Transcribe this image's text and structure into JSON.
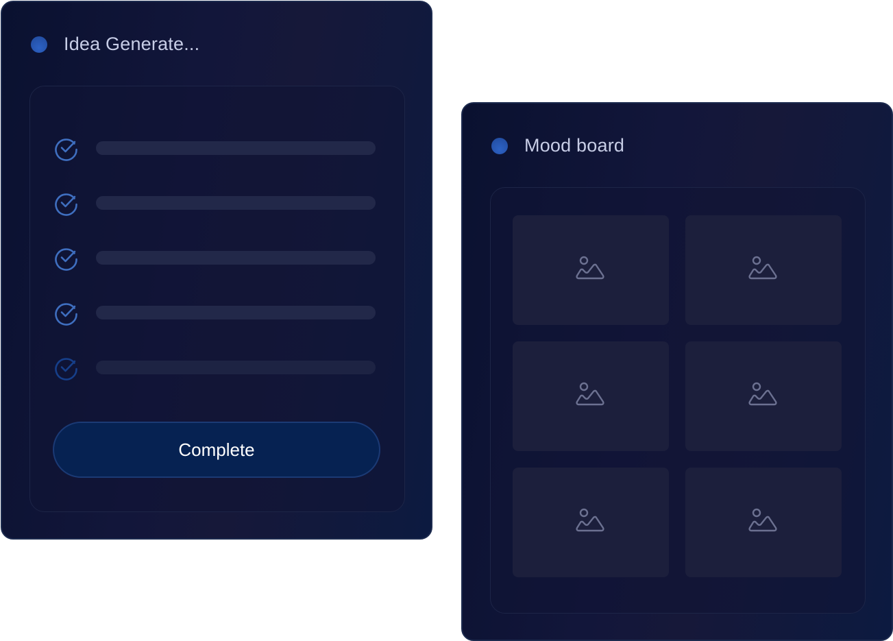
{
  "idea_card": {
    "title": "Idea Generate...",
    "tasks": [
      {
        "state": "done",
        "icon": "check-circle-icon"
      },
      {
        "state": "done",
        "icon": "check-circle-icon"
      },
      {
        "state": "done",
        "icon": "check-circle-icon"
      },
      {
        "state": "done",
        "icon": "check-circle-icon"
      },
      {
        "state": "pending",
        "icon": "check-circle-icon"
      }
    ],
    "complete_label": "Complete"
  },
  "mood_card": {
    "title": "Mood board",
    "tiles": [
      {
        "icon": "image-placeholder-icon"
      },
      {
        "icon": "image-placeholder-icon"
      },
      {
        "icon": "image-placeholder-icon"
      },
      {
        "icon": "image-placeholder-icon"
      },
      {
        "icon": "image-placeholder-icon"
      },
      {
        "icon": "image-placeholder-icon"
      }
    ]
  },
  "colors": {
    "check_done": "#3f6fc0",
    "check_pending": "#163f8a",
    "accent_dot": "#2a5bb8",
    "button_bg": "#062252"
  }
}
